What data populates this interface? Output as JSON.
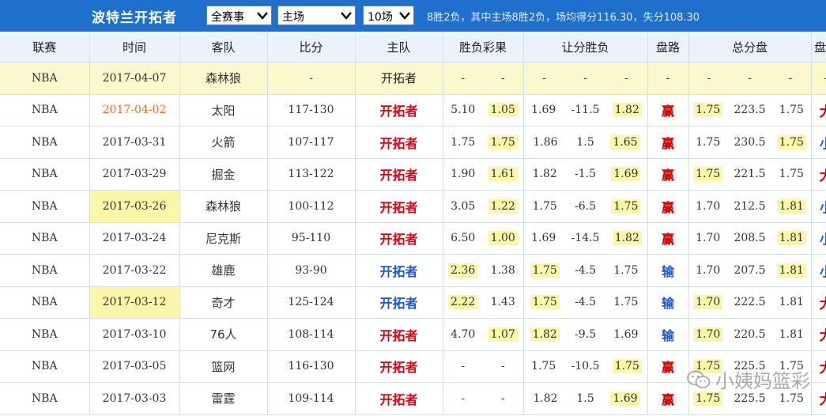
{
  "header": {
    "team_title": "波特兰开拓者",
    "filter_competition": "全赛事",
    "filter_venue": "主场",
    "filter_count": "10场",
    "summary": "8胜2负，其中主场8胜2负，场均得分116.30，失分108.30"
  },
  "columns": {
    "league": "联赛",
    "time": "时间",
    "away": "客队",
    "score": "比分",
    "home": "主队",
    "moneyline": "胜负彩果",
    "spread": "让分胜负",
    "spread_result": "盘路",
    "total": "总分盘",
    "total_result": "盘路"
  },
  "rows": [
    {
      "league": "NBA",
      "date": "2017-04-07",
      "away": "森林狼",
      "score": "-",
      "home": "开拓者",
      "ml": [
        "-",
        "-"
      ],
      "sp": [
        "-",
        "-",
        "-"
      ],
      "spr": "-",
      "tot": [
        "-",
        "-",
        "-"
      ],
      "totr": "-"
    },
    {
      "league": "NBA",
      "date": "2017-04-02",
      "away": "太阳",
      "score": "117-130",
      "home": "开拓者",
      "ml": [
        "5.10",
        "1.05"
      ],
      "sp": [
        "1.69",
        "-11.5",
        "1.82"
      ],
      "spr": "赢",
      "tot": [
        "1.75",
        "223.5",
        "1.75"
      ],
      "totr": "大"
    },
    {
      "league": "NBA",
      "date": "2017-03-31",
      "away": "火箭",
      "score": "107-117",
      "home": "开拓者",
      "ml": [
        "1.75",
        "1.75"
      ],
      "sp": [
        "1.86",
        "1.5",
        "1.65"
      ],
      "spr": "赢",
      "tot": [
        "1.75",
        "230.5",
        "1.75"
      ],
      "totr": "小"
    },
    {
      "league": "NBA",
      "date": "2017-03-29",
      "away": "掘金",
      "score": "113-122",
      "home": "开拓者",
      "ml": [
        "1.90",
        "1.61"
      ],
      "sp": [
        "1.82",
        "-1.5",
        "1.69"
      ],
      "spr": "赢",
      "tot": [
        "1.75",
        "221.5",
        "1.75"
      ],
      "totr": "大"
    },
    {
      "league": "NBA",
      "date": "2017-03-26",
      "away": "森林狼",
      "score": "100-112",
      "home": "开拓者",
      "ml": [
        "3.05",
        "1.22"
      ],
      "sp": [
        "1.75",
        "-6.5",
        "1.75"
      ],
      "spr": "赢",
      "tot": [
        "1.70",
        "212.5",
        "1.81"
      ],
      "totr": "小"
    },
    {
      "league": "NBA",
      "date": "2017-03-24",
      "away": "尼克斯",
      "score": "95-110",
      "home": "开拓者",
      "ml": [
        "6.50",
        "1.00"
      ],
      "sp": [
        "1.69",
        "-14.5",
        "1.82"
      ],
      "spr": "赢",
      "tot": [
        "1.70",
        "208.5",
        "1.81"
      ],
      "totr": "小"
    },
    {
      "league": "NBA",
      "date": "2017-03-22",
      "away": "雄鹿",
      "score": "93-90",
      "home": "开拓者",
      "ml": [
        "2.36",
        "1.38"
      ],
      "sp": [
        "1.75",
        "-4.5",
        "1.75"
      ],
      "spr": "输",
      "tot": [
        "1.70",
        "207.5",
        "1.81"
      ],
      "totr": "小"
    },
    {
      "league": "NBA",
      "date": "2017-03-12",
      "away": "奇才",
      "score": "125-124",
      "home": "开拓者",
      "ml": [
        "2.22",
        "1.43"
      ],
      "sp": [
        "1.75",
        "-4.5",
        "1.75"
      ],
      "spr": "输",
      "tot": [
        "1.70",
        "222.5",
        "1.81"
      ],
      "totr": "大"
    },
    {
      "league": "NBA",
      "date": "2017-03-10",
      "away": "76人",
      "score": "108-114",
      "home": "开拓者",
      "ml": [
        "4.70",
        "1.07"
      ],
      "sp": [
        "1.82",
        "-9.5",
        "1.69"
      ],
      "spr": "输",
      "tot": [
        "1.70",
        "220.5",
        "1.81"
      ],
      "totr": "大"
    },
    {
      "league": "NBA",
      "date": "2017-03-05",
      "away": "篮网",
      "score": "116-130",
      "home": "开拓者",
      "ml": [
        "-",
        "-"
      ],
      "sp": [
        "1.75",
        "-10.5",
        "1.75"
      ],
      "spr": "赢",
      "tot": [
        "1.75",
        "225.5",
        "1.75"
      ],
      "totr": "大"
    },
    {
      "league": "NBA",
      "date": "2017-03-03",
      "away": "雷霆",
      "score": "109-114",
      "home": "开拓者",
      "ml": [
        "-",
        "-"
      ],
      "sp": [
        "1.82",
        "1.5",
        "1.69"
      ],
      "spr": "赢",
      "tot": [
        "1.75",
        "225.5",
        "1.75"
      ],
      "totr": "大"
    }
  ],
  "watermark": "小姨妈篮彩",
  "colors": {
    "title_bar": "#1f6fcd",
    "header_bg": "#eaf2fc",
    "highlight": "#fbf6a8",
    "win_red": "#d40000",
    "lose_blue": "#1a56d6",
    "date_orange": "#ff6a13"
  }
}
